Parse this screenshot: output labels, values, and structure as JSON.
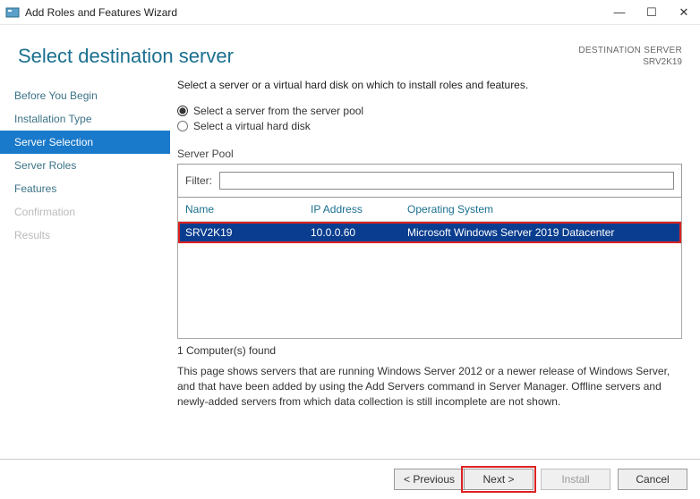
{
  "window": {
    "title": "Add Roles and Features Wizard"
  },
  "header": {
    "title": "Select destination server",
    "dest_label": "DESTINATION SERVER",
    "dest_value": "SRV2K19"
  },
  "sidebar": {
    "steps": [
      {
        "label": "Before You Begin"
      },
      {
        "label": "Installation Type"
      },
      {
        "label": "Server Selection"
      },
      {
        "label": "Server Roles"
      },
      {
        "label": "Features"
      },
      {
        "label": "Confirmation"
      },
      {
        "label": "Results"
      }
    ]
  },
  "content": {
    "intro": "Select a server or a virtual hard disk on which to install roles and features.",
    "radio_pool": "Select a server from the server pool",
    "radio_vhd": "Select a virtual hard disk",
    "section_label": "Server Pool",
    "filter_label": "Filter:",
    "filter_value": "",
    "columns": {
      "name": "Name",
      "ip": "IP Address",
      "os": "Operating System"
    },
    "rows": [
      {
        "name": "SRV2K19",
        "ip": "10.0.0.60",
        "os": "Microsoft Windows Server 2019 Datacenter"
      }
    ],
    "found": "1 Computer(s) found",
    "note": "This page shows servers that are running Windows Server 2012 or a newer release of Windows Server, and that have been added by using the Add Servers command in Server Manager. Offline servers and newly-added servers from which data collection is still incomplete are not shown."
  },
  "footer": {
    "previous": "< Previous",
    "next": "Next >",
    "install": "Install",
    "cancel": "Cancel"
  }
}
